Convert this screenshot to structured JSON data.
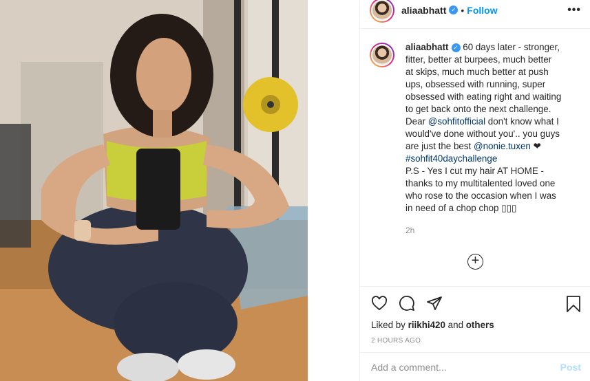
{
  "post": {
    "username": "aliaabhatt",
    "verified_glyph": "✓",
    "separator": "•",
    "follow_label": "Follow",
    "more_label": "•••"
  },
  "caption": {
    "username": "aliaabhatt",
    "lines": [
      "60 days later - stronger,",
      "fitter, better at burpees, much better",
      "at skips, much much better at push",
      "ups, obsessed with running, super",
      "obsessed with eating right and waiting",
      "to get back onto the next challenge."
    ],
    "dear_prefix": "Dear ",
    "mention_1": "@sohfitofficial",
    "after_mention_1": " don't know what I",
    "line_8": "would've done without you'.. you guys",
    "line_9_prefix": "are just the best ",
    "mention_2": "@nonie.tuxen",
    "heart_glyph": " ❤",
    "hashtag": "#sohfit40daychallenge",
    "ps_lines": [
      "P.S - Yes I cut my hair AT HOME -",
      "thanks to my multitalented loved one",
      "who rose to the occasion when I was",
      "in need of a chop chop ▯▯▯"
    ],
    "time": "2h",
    "load_more_glyph": "+"
  },
  "actions": {
    "icons": [
      "heart-icon",
      "comment-icon",
      "share-icon",
      "bookmark-icon"
    ],
    "liked_by_prefix": "Liked by ",
    "liked_by_user": "riikhi420",
    "liked_by_and": " and ",
    "liked_by_others": "others",
    "timestamp": "2 HOURS AGO"
  },
  "comment": {
    "placeholder": "Add a comment...",
    "post_label": "Post"
  },
  "colors": {
    "accent": "#0095f6",
    "verified": "#3897f0",
    "link": "#00376b",
    "muted": "#8e8e8e"
  }
}
